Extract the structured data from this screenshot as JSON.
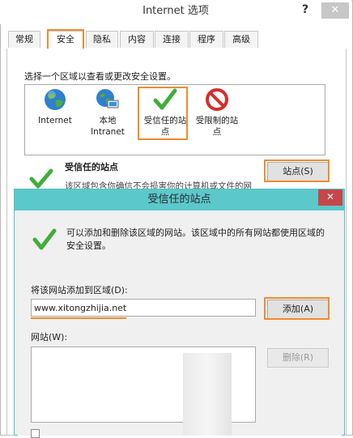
{
  "window": {
    "title": "Internet 选项",
    "help": "?",
    "close": "✕"
  },
  "tabs": [
    "常规",
    "安全",
    "隐私",
    "内容",
    "连接",
    "程序",
    "高级"
  ],
  "security": {
    "prompt": "选择一个区域以查看或更改安全设置。",
    "zones": [
      {
        "label": "Internet",
        "icon": "globe-icon"
      },
      {
        "label": "本地\nIntranet",
        "icon": "intranet-icon"
      },
      {
        "label": "受信任的站\n点",
        "icon": "check-icon"
      },
      {
        "label": "受限制的站\n点",
        "icon": "restricted-icon"
      }
    ],
    "zone_title": "受信任的站点",
    "zone_desc": "该区域包含你确信不会损害你的计算机或文件的网",
    "sites_button": "站点(S)"
  },
  "dialog": {
    "title": "受信任的站点",
    "close": "✕",
    "info": "可以添加和删除该区域的网站。该区域中的所有网站都使用区域的安全设置。",
    "add_label": "将该网站添加到区域(D):",
    "add_value": "www.xitongzhijia.net",
    "add_button": "添加(A)",
    "sites_label": "网站(W):",
    "remove_button": "删除(R)"
  },
  "colors": {
    "highlight": "#f08c2c",
    "dialog_title": "#5bc8cc",
    "check_green": "#3fae3a",
    "restricted_red": "#d92b2b"
  }
}
